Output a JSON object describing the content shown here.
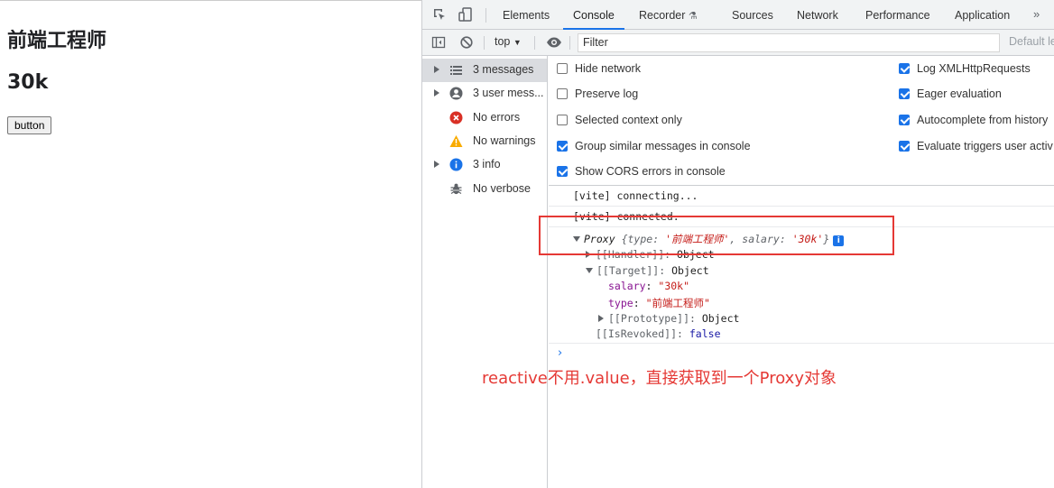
{
  "page": {
    "heading_type": "前端工程师",
    "heading_salary": "30k",
    "button_label": "button"
  },
  "devtools": {
    "tabs": [
      "Elements",
      "Console",
      "Recorder",
      "Sources",
      "Network",
      "Performance",
      "Application"
    ],
    "active_tab": "Console",
    "toolbar": {
      "context": "top",
      "filter_value": "Filter",
      "levels": "Default le"
    },
    "sidebar": [
      {
        "label": "3 messages",
        "icon": "list-icon",
        "expandable": true,
        "selected": true
      },
      {
        "label": "3 user mess...",
        "icon": "user-icon",
        "expandable": true,
        "selected": false
      },
      {
        "label": "No errors",
        "icon": "error-icon",
        "expandable": false,
        "selected": false
      },
      {
        "label": "No warnings",
        "icon": "warning-icon",
        "expandable": false,
        "selected": false
      },
      {
        "label": "3 info",
        "icon": "info-icon",
        "expandable": true,
        "selected": false
      },
      {
        "label": "No verbose",
        "icon": "bug-icon",
        "expandable": false,
        "selected": false
      }
    ],
    "settings": {
      "left": [
        {
          "label": "Hide network",
          "checked": false
        },
        {
          "label": "Preserve log",
          "checked": false
        },
        {
          "label": "Selected context only",
          "checked": false
        },
        {
          "label": "Group similar messages in console",
          "checked": true
        },
        {
          "label": "Show CORS errors in console",
          "checked": true
        }
      ],
      "right": [
        {
          "label": "Log XMLHttpRequests",
          "checked": true
        },
        {
          "label": "Eager evaluation",
          "checked": true
        },
        {
          "label": "Autocomplete from history",
          "checked": true
        },
        {
          "label": "Evaluate triggers user activ",
          "checked": true
        }
      ]
    },
    "console": {
      "messages": [
        "[vite] connecting...",
        "[vite] connected."
      ],
      "proxy": {
        "name": "Proxy",
        "preview_open": "{",
        "type_key": "type",
        "type_value": "'前端工程师'",
        "salary_key": "salary",
        "salary_value": "'30k'",
        "preview_close": "}",
        "handler": "[[Handler]]",
        "handler_value": "Object",
        "target": "[[Target]]",
        "target_value": "Object",
        "target_salary_key": "salary",
        "target_salary_value": "\"30k\"",
        "target_type_key": "type",
        "target_type_value": "\"前端工程师\"",
        "prototype": "[[Prototype]]",
        "prototype_value": "Object",
        "revoked": "[[IsRevoked]]",
        "revoked_value": "false"
      }
    }
  },
  "annotation": "reactive不用.value，直接获取到一个Proxy对象",
  "colors": {
    "accent": "#1a73e8",
    "annotation": "#e53935"
  }
}
